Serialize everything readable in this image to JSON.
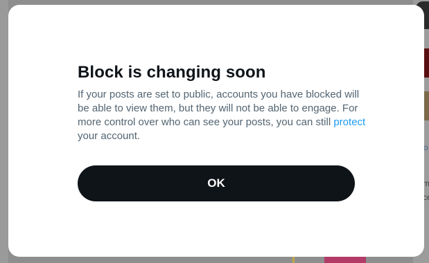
{
  "background": {
    "fragment_right_1": "o",
    "fragment_right_2": "m",
    "fragment_right_3": "ce"
  },
  "dialog": {
    "title": "Block is changing soon",
    "body_before_link": "If your posts are set to public, accounts you have blocked will be able to view them, but they will not be able to engage. For more control over who can see your posts, you can still ",
    "link_text": "protect",
    "body_after_link": " your account.",
    "ok_label": "OK"
  },
  "colors": {
    "title": "#0f1419",
    "body_text": "#536471",
    "link": "#1d9bf0",
    "button_bg": "#0f1419",
    "button_text": "#ffffff",
    "overlay": "#8e8e8e"
  }
}
